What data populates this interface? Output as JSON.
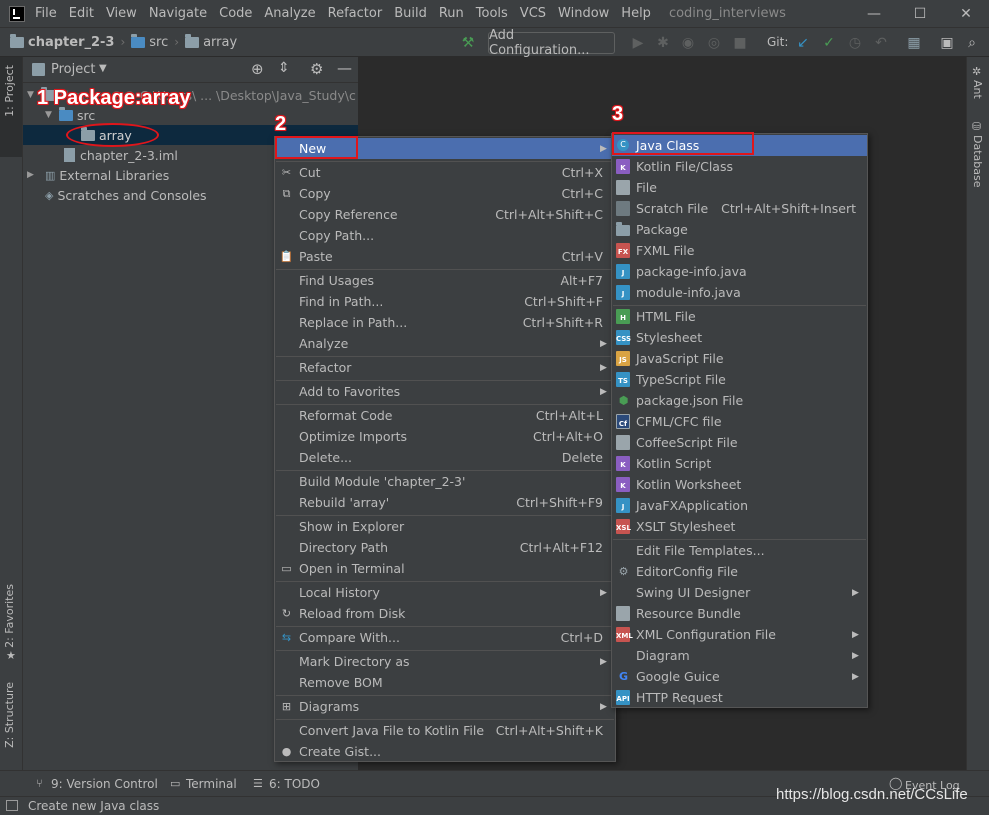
{
  "menubar": {
    "items": [
      "File",
      "Edit",
      "View",
      "Navigate",
      "Code",
      "Analyze",
      "Refactor",
      "Build",
      "Run",
      "Tools",
      "VCS",
      "Window",
      "Help"
    ],
    "project_name": "coding_interviews"
  },
  "window_controls": {
    "minimize": "—",
    "maximize": "☐",
    "close": "✕"
  },
  "breadcrumb": [
    "chapter_2-3",
    "src",
    "array"
  ],
  "toolbar": {
    "add_configuration": "Add Configuration...",
    "git_label": "Git:"
  },
  "left_strip": {
    "project_tab": "1: Project",
    "favorites_tab": "2: Favorites",
    "structure_tab": "Z: Structure"
  },
  "right_strip": {
    "ant_tab": "Ant",
    "database_tab": "Database"
  },
  "project_panel": {
    "title": "Project",
    "root_label": "chapter_2-3",
    "root_path": "C:\\Users\\ ... \\Desktop\\Java_Study\\c",
    "src_label": "src",
    "array_label": "array",
    "iml_label": "chapter_2-3.iml",
    "external_libs": "External Libraries",
    "scratches": "Scratches and Consoles"
  },
  "annotations": {
    "step1": "1 Package:array",
    "step2": "2",
    "step3": "3"
  },
  "context_menu": {
    "new": "New",
    "cut": "Cut",
    "cut_sc": "Ctrl+X",
    "copy": "Copy",
    "copy_sc": "Ctrl+C",
    "copy_ref": "Copy Reference",
    "copy_ref_sc": "Ctrl+Alt+Shift+C",
    "copy_path": "Copy Path...",
    "paste": "Paste",
    "paste_sc": "Ctrl+V",
    "find_usages": "Find Usages",
    "find_usages_sc": "Alt+F7",
    "find_in_path": "Find in Path...",
    "find_in_path_sc": "Ctrl+Shift+F",
    "replace_in_path": "Replace in Path...",
    "replace_in_path_sc": "Ctrl+Shift+R",
    "analyze": "Analyze",
    "refactor": "Refactor",
    "add_favorites": "Add to Favorites",
    "reformat": "Reformat Code",
    "reformat_sc": "Ctrl+Alt+L",
    "optimize": "Optimize Imports",
    "optimize_sc": "Ctrl+Alt+O",
    "delete": "Delete...",
    "delete_sc": "Delete",
    "build_module": "Build Module 'chapter_2-3'",
    "rebuild": "Rebuild 'array'",
    "rebuild_sc": "Ctrl+Shift+F9",
    "show_explorer": "Show in Explorer",
    "dir_path": "Directory Path",
    "dir_path_sc": "Ctrl+Alt+F12",
    "open_terminal": "Open in Terminal",
    "local_history": "Local History",
    "reload": "Reload from Disk",
    "compare": "Compare With...",
    "compare_sc": "Ctrl+D",
    "mark_dir": "Mark Directory as",
    "remove_bom": "Remove BOM",
    "diagrams": "Diagrams",
    "convert_kotlin": "Convert Java File to Kotlin File",
    "convert_kotlin_sc": "Ctrl+Alt+Shift+K",
    "create_gist": "Create Gist..."
  },
  "new_submenu": {
    "java_class": "Java Class",
    "kotlin_file": "Kotlin File/Class",
    "file": "File",
    "scratch": "Scratch File",
    "scratch_sc": "Ctrl+Alt+Shift+Insert",
    "package": "Package",
    "fxml": "FXML File",
    "package_info": "package-info.java",
    "module_info": "module-info.java",
    "html": "HTML File",
    "stylesheet": "Stylesheet",
    "javascript": "JavaScript File",
    "typescript": "TypeScript File",
    "package_json": "package.json File",
    "cfml": "CFML/CFC file",
    "coffeescript": "CoffeeScript File",
    "kotlin_script": "Kotlin Script",
    "kotlin_worksheet": "Kotlin Worksheet",
    "javafx": "JavaFXApplication",
    "xslt": "XSLT Stylesheet",
    "edit_templates": "Edit File Templates...",
    "editorconfig": "EditorConfig File",
    "swing": "Swing UI Designer",
    "resource_bundle": "Resource Bundle",
    "xml_config": "XML Configuration File",
    "diagram": "Diagram",
    "google_guice": "Google Guice",
    "http_request": "HTTP Request"
  },
  "bottom_tabs": {
    "version_control": "9: Version Control",
    "terminal": "Terminal",
    "todo": "6: TODO",
    "event_log": "Event Log"
  },
  "status": {
    "message": "Create new Java class",
    "watermark": "https://blog.csdn.net/CCsLife"
  },
  "colors": {
    "accent": "#4b6eaf",
    "annotation": "#e0161b",
    "panel": "#3c3f41",
    "editor": "#2b2b2b"
  }
}
